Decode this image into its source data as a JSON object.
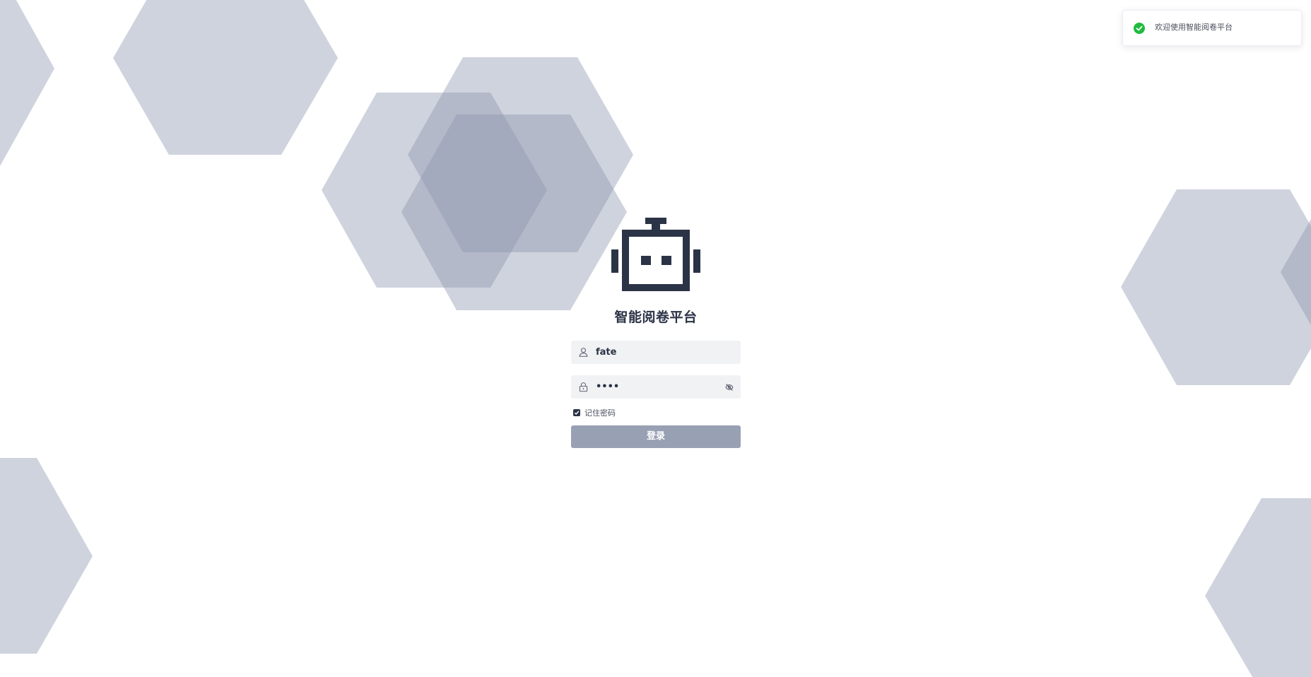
{
  "app": {
    "title": "智能阅卷平台"
  },
  "login": {
    "username_value": "fate",
    "password_masked": "••••",
    "remember_label": "记住密码",
    "remember_checked": true,
    "submit_label": "登录"
  },
  "toast": {
    "message": "欢迎使用智能阅卷平台",
    "type": "success"
  },
  "icons": {
    "logo": "robot-icon",
    "username": "user-icon",
    "password": "lock-icon",
    "visibility": "eye-off-icon",
    "toast": "check-circle-icon"
  },
  "colors": {
    "primary": "#2b3346",
    "button": "#98a1b3",
    "field_bg": "#f1f2f4",
    "hexagon": "#8c95ad",
    "success": "#1fbb3e"
  }
}
